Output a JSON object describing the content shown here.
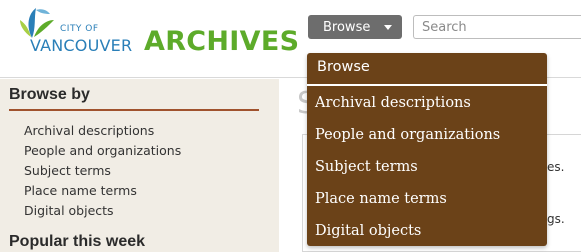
{
  "header": {
    "logo": {
      "city_text": "CITY OF",
      "vancouver_text": "VANCOUVER",
      "archives_text": "ARCHIVES"
    },
    "browse_button_label": "Browse",
    "search": {
      "placeholder": "Search",
      "value": ""
    }
  },
  "sidebar": {
    "browse_by_heading": "Browse by",
    "items": [
      {
        "label": "Archival descriptions"
      },
      {
        "label": "People and organizations"
      },
      {
        "label": "Subject terms"
      },
      {
        "label": "Place name terms"
      },
      {
        "label": "Digital objects"
      }
    ],
    "popular_heading": "Popular this week"
  },
  "main": {
    "title_fragment": "S",
    "text_fragment_1": "es.",
    "text_fragment_2": "gs."
  },
  "dropdown": {
    "header": "Browse",
    "items": [
      {
        "label": "Archival descriptions"
      },
      {
        "label": "People and organizations"
      },
      {
        "label": "Subject terms"
      },
      {
        "label": "Place name terms"
      },
      {
        "label": "Digital objects"
      }
    ]
  },
  "colors": {
    "brand_green": "#5dab2a",
    "brand_blue": "#2a7fb8",
    "dropdown_brown": "#6b4218",
    "sidebar_rule": "#a0522d",
    "sidebar_bg": "#f1ede5",
    "browse_button_bg": "#6d6d6d"
  }
}
